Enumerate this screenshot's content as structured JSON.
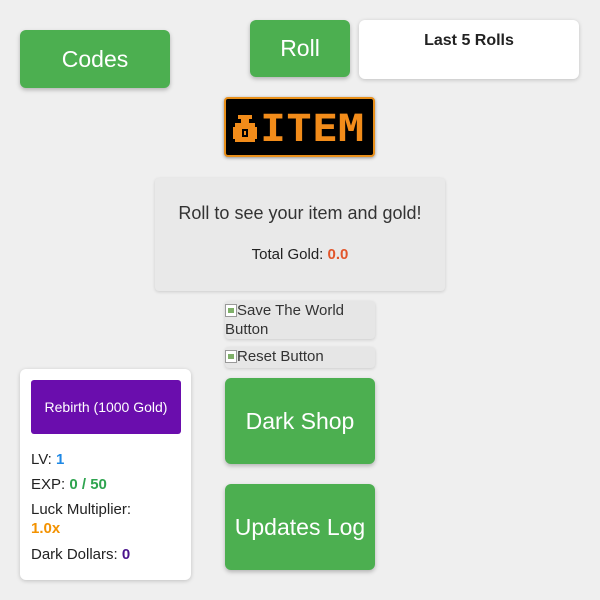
{
  "buttons": {
    "codes": "Codes",
    "roll": "Roll",
    "dark_shop": "Dark Shop",
    "updates_log": "Updates Log"
  },
  "last_rolls": {
    "title": "Last 5 Rolls"
  },
  "logo": {
    "text": "ITEM"
  },
  "result": {
    "message": "Roll to see your item and gold!",
    "gold_label": "Total Gold:",
    "gold_value": "0.0"
  },
  "image_buttons": {
    "save_world": "Save The World Button",
    "reset": "Reset Button"
  },
  "stats": {
    "rebirth_label": "Rebirth (1000 Gold)",
    "lv_label": "LV:",
    "lv_value": "1",
    "exp_label": "EXP:",
    "exp_value": "0 / 50",
    "luck_label": "Luck Multiplier:",
    "luck_value": "1.0x",
    "dark_dollars_label": "Dark Dollars:",
    "dark_dollars_value": "0"
  },
  "colors": {
    "green_button": "#4caf50",
    "rebirth_purple": "#6a0dad",
    "gold_value": "#e2562b",
    "logo_orange": "#f28c1a"
  }
}
